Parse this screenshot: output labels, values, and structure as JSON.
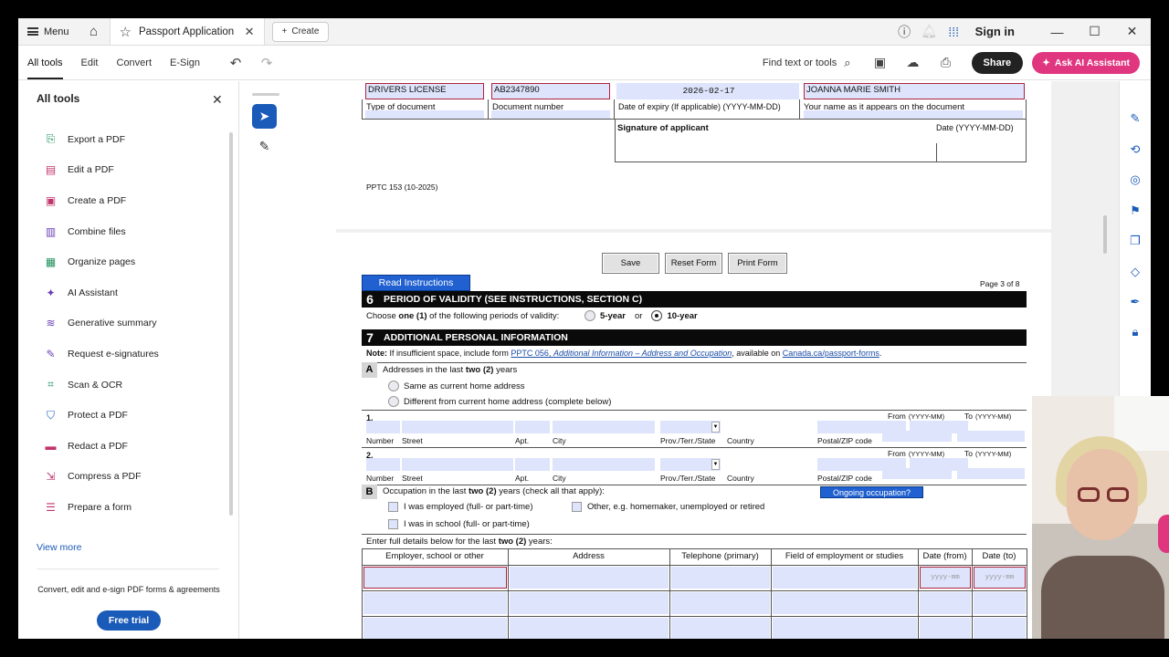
{
  "tabbar": {
    "menu_label": "Menu",
    "tab_title": "Passport Application FIL...",
    "create_label": "Create",
    "signin_label": "Sign in"
  },
  "toolbar": {
    "items": [
      "All tools",
      "Edit",
      "Convert",
      "E-Sign"
    ],
    "find_label": "Find text or tools",
    "share_label": "Share",
    "ai_label": "Ask AI Assistant"
  },
  "leftpanel": {
    "title": "All tools",
    "items": [
      {
        "label": "Export a PDF",
        "icon": "export-pdf-icon",
        "color": "#1c8f5a",
        "glyph": "⎘"
      },
      {
        "label": "Edit a PDF",
        "icon": "edit-pdf-icon",
        "color": "#c0336b",
        "glyph": "▤"
      },
      {
        "label": "Create a PDF",
        "icon": "create-pdf-icon",
        "color": "#c0336b",
        "glyph": "▣"
      },
      {
        "label": "Combine files",
        "icon": "combine-files-icon",
        "color": "#6b3fb8",
        "glyph": "▥"
      },
      {
        "label": "Organize pages",
        "icon": "organize-pages-icon",
        "color": "#1c8f5a",
        "glyph": "▦"
      },
      {
        "label": "AI Assistant",
        "icon": "ai-assistant-icon",
        "color": "#6b3fb8",
        "glyph": "✦"
      },
      {
        "label": "Generative summary",
        "icon": "generative-summary-icon",
        "color": "#6b3fb8",
        "glyph": "≋"
      },
      {
        "label": "Request e-signatures",
        "icon": "request-esignatures-icon",
        "color": "#6b3fb8",
        "glyph": "✎"
      },
      {
        "label": "Scan & OCR",
        "icon": "scan-ocr-icon",
        "color": "#1c8f5a",
        "glyph": "⌗"
      },
      {
        "label": "Protect a PDF",
        "icon": "protect-pdf-icon",
        "color": "#1a5ab8",
        "glyph": "⛉"
      },
      {
        "label": "Redact a PDF",
        "icon": "redact-pdf-icon",
        "color": "#c0336b",
        "glyph": "▬"
      },
      {
        "label": "Compress a PDF",
        "icon": "compress-pdf-icon",
        "color": "#c0336b",
        "glyph": "⇲"
      },
      {
        "label": "Prepare a form",
        "icon": "prepare-form-icon",
        "color": "#c0336b",
        "glyph": "☰"
      }
    ],
    "view_more": "View more",
    "promo_text": "Convert, edit and e-sign PDF forms & agreements",
    "free_trial": "Free trial"
  },
  "page1": {
    "doc_type_value": "DRIVERS LICENSE",
    "doc_number_value": "AB2347890",
    "expiry_value": "2026-02-17",
    "name_value": "JOANNA MARIE SMITH",
    "type_label": "Type of document",
    "number_label": "Document number",
    "expiry_label": "Date of expiry (If applicable) (YYYY-MM-DD)",
    "name_label": "Your name as it appears on the document",
    "signature_label": "Signature of applicant",
    "date_label": "Date (YYYY-MM-DD)",
    "form_code": "PPTC 153 (10-2025)"
  },
  "page2": {
    "save": "Save",
    "reset": "Reset Form",
    "print": "Print Form",
    "page_label": "Page 3 of 8",
    "read_instructions": "Read Instructions",
    "sec6_num": "6",
    "sec6_title": "PERIOD OF VALIDITY (SEE INSTRUCTIONS, SECTION C)",
    "choose_pre": "Choose ",
    "choose_bold": "one (1)",
    "choose_post": " of the following periods of validity:",
    "opt5": "5-year",
    "or": "or",
    "opt10": "10-year",
    "sec7_num": "7",
    "sec7_title": "ADDITIONAL PERSONAL INFORMATION",
    "note_bold": "Note:",
    "note_text": " If insufficient space, include form ",
    "note_link": "PPTC 056, ",
    "note_link_italic": "Additional Information – Address and Occupation",
    "note_mid": ", available on ",
    "note_link2": "Canada.ca/passport-forms",
    "note_end": ".",
    "a_letter": "A",
    "a_text_pre": "Addresses in the last ",
    "a_text_bold": "two (2)",
    "a_text_post": " years",
    "opt_same": "Same as current home address",
    "opt_diff": "Different from current home address (complete below)",
    "row1": "1.",
    "row2": "2.",
    "addr_labels": {
      "number": "Number",
      "street": "Street",
      "apt": "Apt.",
      "city": "City",
      "prov": "Prov./Terr./State",
      "country": "Country",
      "postal": "Postal/ZIP code",
      "from": "From",
      "from_fmt": "(YYYY-MM)",
      "to": "To",
      "to_fmt": "(YYYY-MM)"
    },
    "b_letter": "B",
    "b_text_pre": "Occupation in the last ",
    "b_text_bold": "two (2)",
    "b_text_post": " years (check all that apply):",
    "ongoing": "Ongoing occupation?",
    "chk_employed": "I was employed (full- or part-time)",
    "chk_other": "Other, e.g. homemaker, unemployed or retired",
    "chk_school": "I was in school (full- or part-time)",
    "full_pre": "Enter full details below for the last ",
    "full_bold": "two (2)",
    "full_post": " years:",
    "table_headers": [
      "Employer, school or other",
      "Address",
      "Telephone (primary)",
      "Field of employment or studies",
      "Date (from)",
      "Date (to)"
    ],
    "date_placeholder": "yyyy-mm"
  }
}
